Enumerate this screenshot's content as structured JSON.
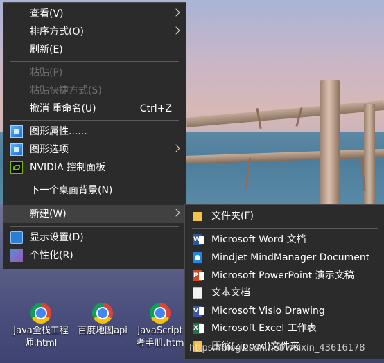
{
  "context_menu": {
    "items": [
      {
        "label": "查看(V)"
      },
      {
        "label": "排序方式(O)"
      },
      {
        "label": "刷新(E)"
      },
      {
        "label": "粘贴(P)"
      },
      {
        "label": "粘贴快捷方式(S)"
      },
      {
        "label": "撤消 重命名(U)",
        "shortcut": "Ctrl+Z"
      },
      {
        "label": "图形属性......",
        "icon": "graphics-properties-icon"
      },
      {
        "label": "图形选项",
        "icon": "graphics-options-icon"
      },
      {
        "label": "NVIDIA 控制面板",
        "icon": "nvidia-icon"
      },
      {
        "label": "下一个桌面背景(N)"
      },
      {
        "label": "新建(W)"
      },
      {
        "label": "显示设置(D)",
        "icon": "display-settings-icon"
      },
      {
        "label": "个性化(R)",
        "icon": "personalize-icon"
      }
    ]
  },
  "new_submenu": {
    "items": [
      {
        "label": "文件夹(F)",
        "icon": "folder-icon"
      },
      {
        "label": "Microsoft Word 文档",
        "icon": "word-icon"
      },
      {
        "label": "Mindjet MindManager Document",
        "icon": "mindmanager-icon"
      },
      {
        "label": "Microsoft PowerPoint 演示文稿",
        "icon": "powerpoint-icon"
      },
      {
        "label": "文本文档",
        "icon": "text-document-icon"
      },
      {
        "label": "Microsoft Visio Drawing",
        "icon": "visio-icon"
      },
      {
        "label": "Microsoft Excel 工作表",
        "icon": "excel-icon"
      },
      {
        "label": "压缩(zipped)文件夹",
        "icon": "zip-folder-icon"
      }
    ]
  },
  "desktop_icons": [
    {
      "label_line1": "Java全栈工程",
      "label_line2": "师.html",
      "icon": "chrome-icon"
    },
    {
      "label_line1": "百度地图api",
      "label_line2": "",
      "icon": "chrome-icon"
    },
    {
      "label_line1": "JavaScript",
      "label_line2": "考手册.htm",
      "icon": "chrome-icon"
    }
  ],
  "watermark": "https://blog.csdn.net/weixin_43616178",
  "colors": {
    "menu_bg": "#2b2b2b",
    "menu_hover": "#414141",
    "disabled_text": "#6e6e6e"
  }
}
